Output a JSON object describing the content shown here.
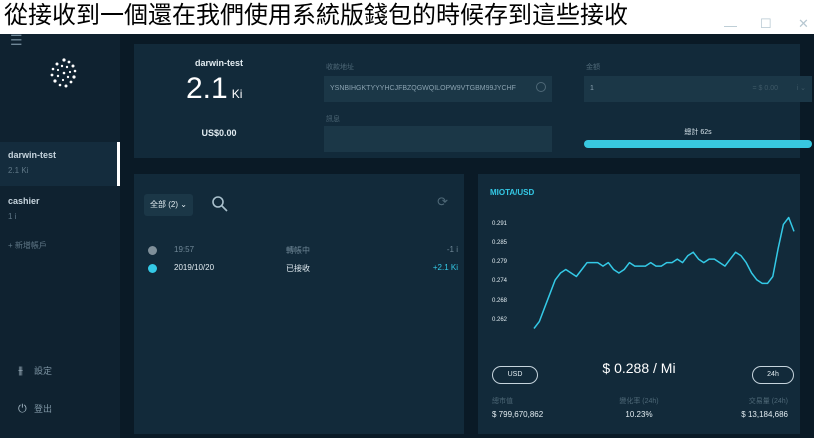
{
  "banner": {
    "text": "從接收到一個還在我們使用系統版錢包的時候存到這些接收"
  },
  "window": {
    "minimize": "—",
    "maximize": "☐",
    "close": "✕"
  },
  "sidebar": {
    "menu_icon": "hamburger-icon",
    "accounts": [
      {
        "name": "darwin-test",
        "balance": "2.1 Ki"
      },
      {
        "name": "cashier",
        "balance": "1 i"
      }
    ],
    "add_account": "+ 新增帳戶",
    "settings": "設定",
    "logout": "登出"
  },
  "wallet": {
    "name": "darwin-test",
    "balance": "2.1",
    "unit": "Ki",
    "usd": "US$0.00"
  },
  "send": {
    "address_label": "收款地址",
    "address_value": "YSNBIHGKTYYYHCJFBZQGWQILOPW9VTGBM99JYCHF",
    "amount_label": "金額",
    "amount_value": "1",
    "amount_usd": "= $ 0.00",
    "amount_unit": "i",
    "message_label": "訊息",
    "message_value": "",
    "countdown": "總計 62s",
    "progress": 1.0
  },
  "history": {
    "filter": "全部 (2)",
    "rows": [
      {
        "time": "19:57",
        "status": "轉帳中",
        "amount": "-1 i",
        "dot": "#7f8f99"
      },
      {
        "time": "2019/10/20",
        "status": "已接收",
        "amount": "+2.1 Ki",
        "dot": "#34c9e6"
      }
    ]
  },
  "market": {
    "title": "MIOTA/USD",
    "currency_button": "USD",
    "range_button": "24h",
    "price": "$ 0.288 / Mi",
    "stats": [
      {
        "label": "總市值",
        "value": "$ 799,670,862"
      },
      {
        "label": "變化率 (24h)",
        "value": "10.23%"
      },
      {
        "label": "交易量 (24h)",
        "value": "$ 13,184,686"
      }
    ]
  },
  "chart_data": {
    "type": "line",
    "title": "MIOTA/USD",
    "yticks": [
      "0.291",
      "0.285",
      "0.279",
      "0.274",
      "0.268",
      "0.262"
    ],
    "ylim": [
      0.259,
      0.293
    ],
    "grid": false,
    "series": [
      {
        "values": [
          0.26,
          0.262,
          0.266,
          0.27,
          0.274,
          0.276,
          0.277,
          0.276,
          0.275,
          0.277,
          0.279,
          0.279,
          0.279,
          0.278,
          0.279,
          0.277,
          0.276,
          0.277,
          0.279,
          0.278,
          0.278,
          0.278,
          0.279,
          0.278,
          0.278,
          0.279,
          0.279,
          0.28,
          0.279,
          0.281,
          0.282,
          0.28,
          0.279,
          0.28,
          0.28,
          0.279,
          0.278,
          0.28,
          0.282,
          0.281,
          0.279,
          0.276,
          0.274,
          0.273,
          0.273,
          0.275,
          0.283,
          0.29,
          0.292,
          0.288
        ]
      }
    ],
    "color": "#34c9e6"
  }
}
